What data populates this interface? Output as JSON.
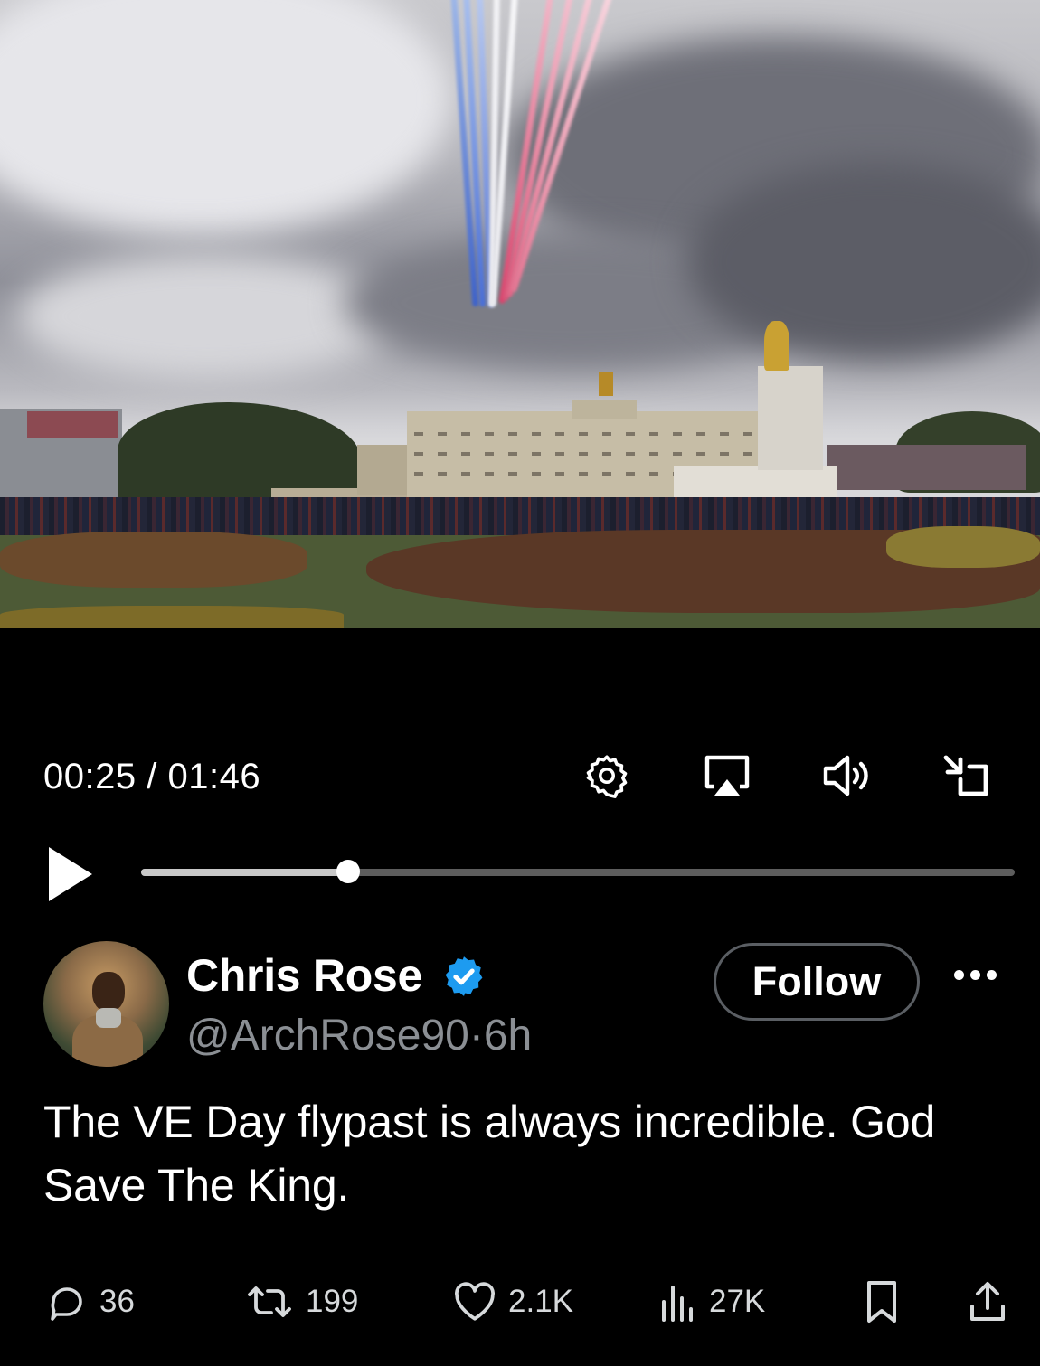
{
  "video": {
    "current_time": "00:25",
    "separator": "/",
    "duration": "01:46",
    "progress": 0.237
  },
  "controls": {
    "play": "play-icon",
    "settings": "gear-icon",
    "airplay": "airplay-icon",
    "volume": "speaker-icon",
    "minimize": "minimize-icon"
  },
  "post": {
    "author_name": "Chris Rose",
    "verified": true,
    "handle": "@ArchRose90",
    "dot": "·",
    "time_ago": "6h",
    "follow_label": "Follow",
    "text": "The VE Day flypast is always incredible. God Save The King."
  },
  "actions": {
    "replies": "36",
    "reposts": "199",
    "likes": "2.1K",
    "views": "27K"
  },
  "colors": {
    "background": "#000000",
    "verified_badge": "#1d9bf0",
    "handle_gray": "#8b8f94",
    "track_bg": "#5d5d5d",
    "track_fill": "#c8c8c8"
  }
}
